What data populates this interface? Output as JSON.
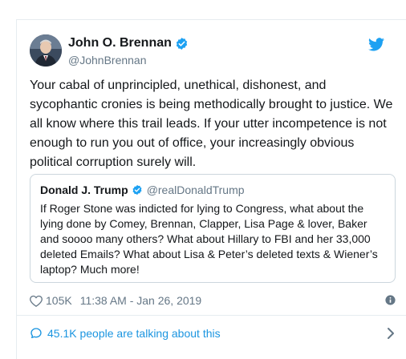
{
  "tweet": {
    "author_name": "John O. Brennan",
    "author_handle": "@JohnBrennan",
    "text": "Your cabal of unprincipled, unethical, dishonest, and sycophantic cronies is being methodically brought to justice. We all know where this trail leads. If your utter incompetence is not enough to run you out of office, your increasingly obvious political corruption surely will.",
    "likes": "105K",
    "timestamp": "11:38 AM - Jan 26, 2019",
    "talking": "45.1K people are talking about this"
  },
  "quoted": {
    "author_name": "Donald J. Trump",
    "author_handle": "@realDonaldTrump",
    "text": "If Roger Stone was indicted for lying to Congress, what about the lying done by Comey, Brennan, Clapper, Lisa Page & lover, Baker and soooo many others? What about Hillary to FBI and her 33,000 deleted Emails? What about Lisa & Peter’s deleted texts & Wiener’s laptop? Much more!"
  },
  "icons": {
    "verified": "verified-badge-icon",
    "twitter": "twitter-bird-icon",
    "like": "heart-icon",
    "info": "info-icon",
    "reply": "speech-bubble-icon",
    "chevron": "chevron-right-icon"
  },
  "colors": {
    "brand_blue": "#1da1f2",
    "link_blue": "#1b95e0",
    "secondary_text": "#657786",
    "border": "#ccd6dd"
  }
}
